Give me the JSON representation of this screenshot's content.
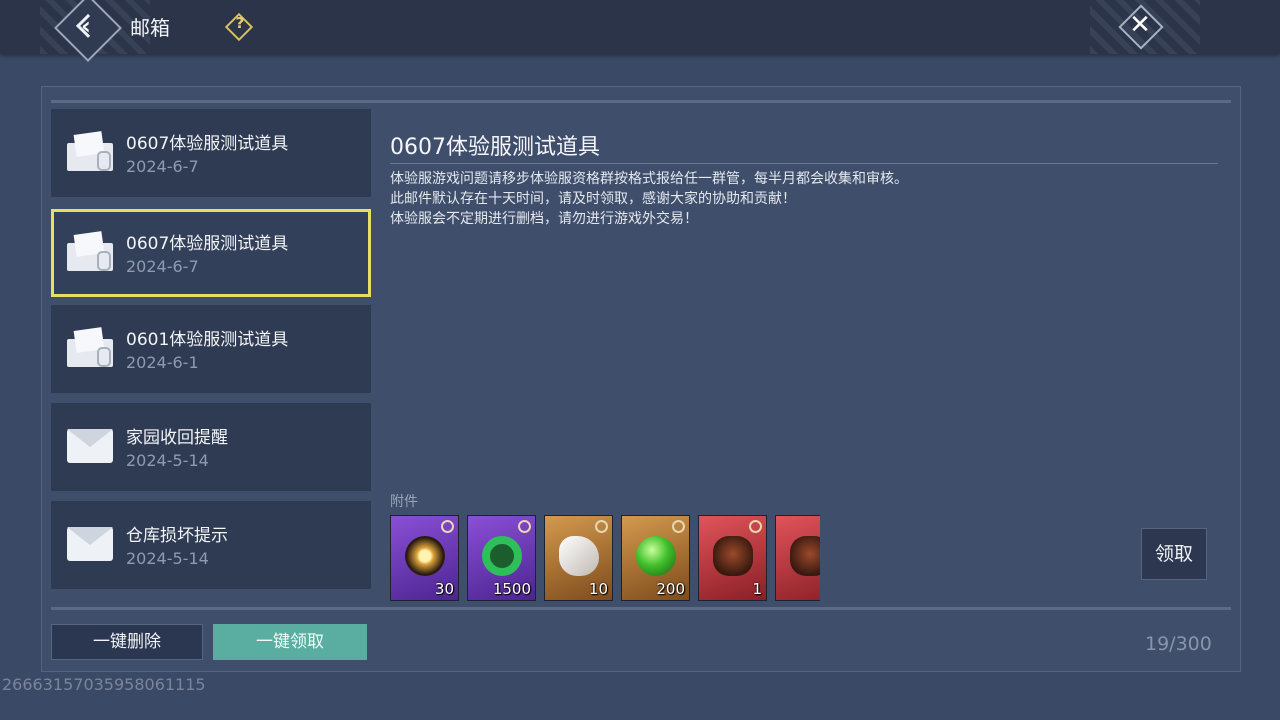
{
  "header": {
    "title": "邮箱",
    "help_label": "?"
  },
  "mails": [
    {
      "title": "0607体验服测试道具",
      "date": "2024-6-7",
      "icon": "open-envelope-icon",
      "selected": false
    },
    {
      "title": "0607体验服测试道具",
      "date": "2024-6-7",
      "icon": "open-envelope-icon",
      "selected": true
    },
    {
      "title": "0601体验服测试道具",
      "date": "2024-6-1",
      "icon": "open-envelope-icon",
      "selected": false
    },
    {
      "title": "家园收回提醒",
      "date": "2024-5-14",
      "icon": "envelope-icon",
      "selected": false
    },
    {
      "title": "仓库损坏提示",
      "date": "2024-5-14",
      "icon": "envelope-icon",
      "selected": false
    }
  ],
  "detail": {
    "title": "0607体验服测试道具",
    "body": [
      "体验服游戏问题请移步体验服资格群按格式报给任一群管，每半月都会收集和审核。",
      "此邮件默认存在十天时间，请及时领取，感谢大家的协助和贡献！",
      "体验服会不定期进行删档，请勿进行游戏外交易！"
    ],
    "attachments_label": "附件",
    "attachments": [
      {
        "qty": "30",
        "rarity": "purple",
        "icon": "sun-medallion-icon"
      },
      {
        "qty": "1500",
        "rarity": "purple",
        "icon": "jade-ring-icon"
      },
      {
        "qty": "10",
        "rarity": "orange",
        "icon": "white-stone-icon"
      },
      {
        "qty": "200",
        "rarity": "orange",
        "icon": "green-orb-icon"
      },
      {
        "qty": "1",
        "rarity": "red",
        "icon": "wolf-head-icon"
      },
      {
        "qty": "",
        "rarity": "red",
        "icon": "wolf-head-icon"
      }
    ],
    "claim_label": "领取"
  },
  "footer": {
    "delete_all_label": "一键删除",
    "claim_all_label": "一键领取",
    "count": "19/300"
  },
  "uid": "2666315703595806111­5",
  "colors": {
    "selected_border": "#e7df62",
    "claim_all_bg": "#5aaea1",
    "panel_bg": "#3f4e6b"
  }
}
